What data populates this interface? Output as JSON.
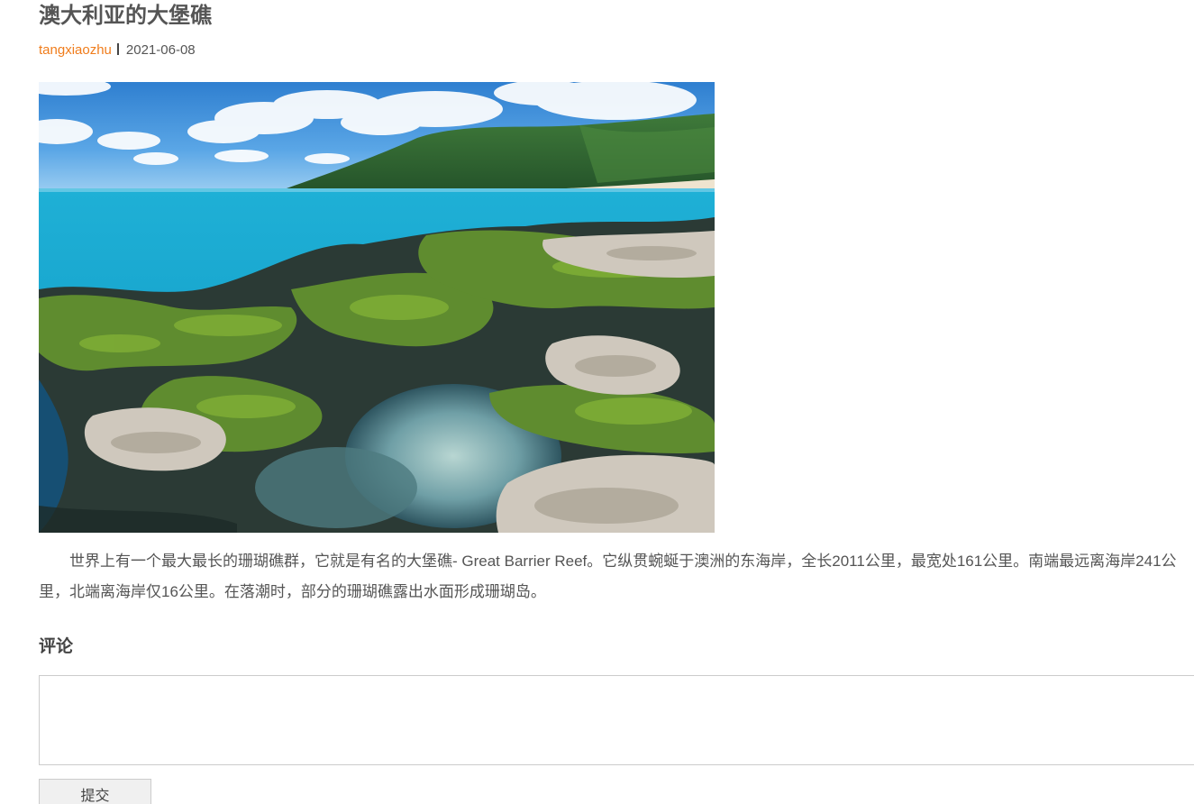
{
  "article": {
    "title": "澳大利亚的大堡礁",
    "author": "tangxiaozhu",
    "date": "2021-06-08",
    "image_alt": "大堡礁海岸照片",
    "body": "世界上有一个最大最长的珊瑚礁群，它就是有名的大堡礁- Great Barrier Reef。它纵贯蜿蜒于澳洲的东海岸，全长2011公里，最宽处161公里。南端最远离海岸241公里，北端离海岸仅16公里。在落潮时，部分的珊瑚礁露出水面形成珊瑚岛。"
  },
  "comments": {
    "heading": "评论",
    "input_value": "",
    "submit_label": "提交"
  }
}
